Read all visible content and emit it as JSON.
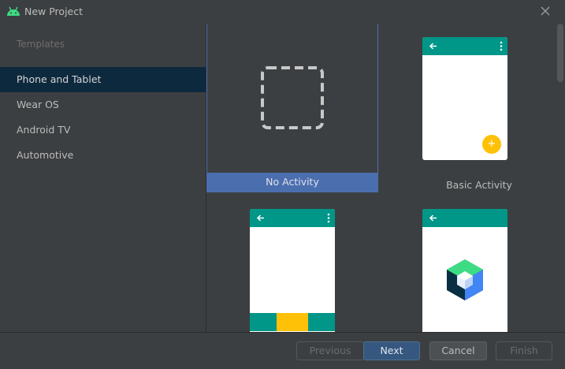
{
  "window": {
    "title": "New Project",
    "close_icon": "close-icon",
    "app_icon": "android-icon"
  },
  "sidebar": {
    "heading": "Templates",
    "items": [
      {
        "label": "Phone and Tablet",
        "selected": true
      },
      {
        "label": "Wear OS",
        "selected": false
      },
      {
        "label": "Android TV",
        "selected": false
      },
      {
        "label": "Automotive",
        "selected": false
      }
    ]
  },
  "templates": [
    {
      "label": "No Activity",
      "selected": true,
      "preview": "dashed-square-icon"
    },
    {
      "label": "Basic Activity",
      "selected": false,
      "preview": "phone-with-fab"
    },
    {
      "label": "",
      "selected": false,
      "preview": "phone-with-bottom-navigation"
    },
    {
      "label": "",
      "selected": false,
      "preview": "phone-with-compose-logo"
    }
  ],
  "colors": {
    "accent": "#4b6eaf",
    "app_bar": "#009688",
    "fab": "#ffc107",
    "sidebar_selected": "#0d293e",
    "primary_button": "#365880"
  },
  "footer": {
    "previous_label": "Previous",
    "next_label": "Next",
    "cancel_label": "Cancel",
    "finish_label": "Finish"
  }
}
